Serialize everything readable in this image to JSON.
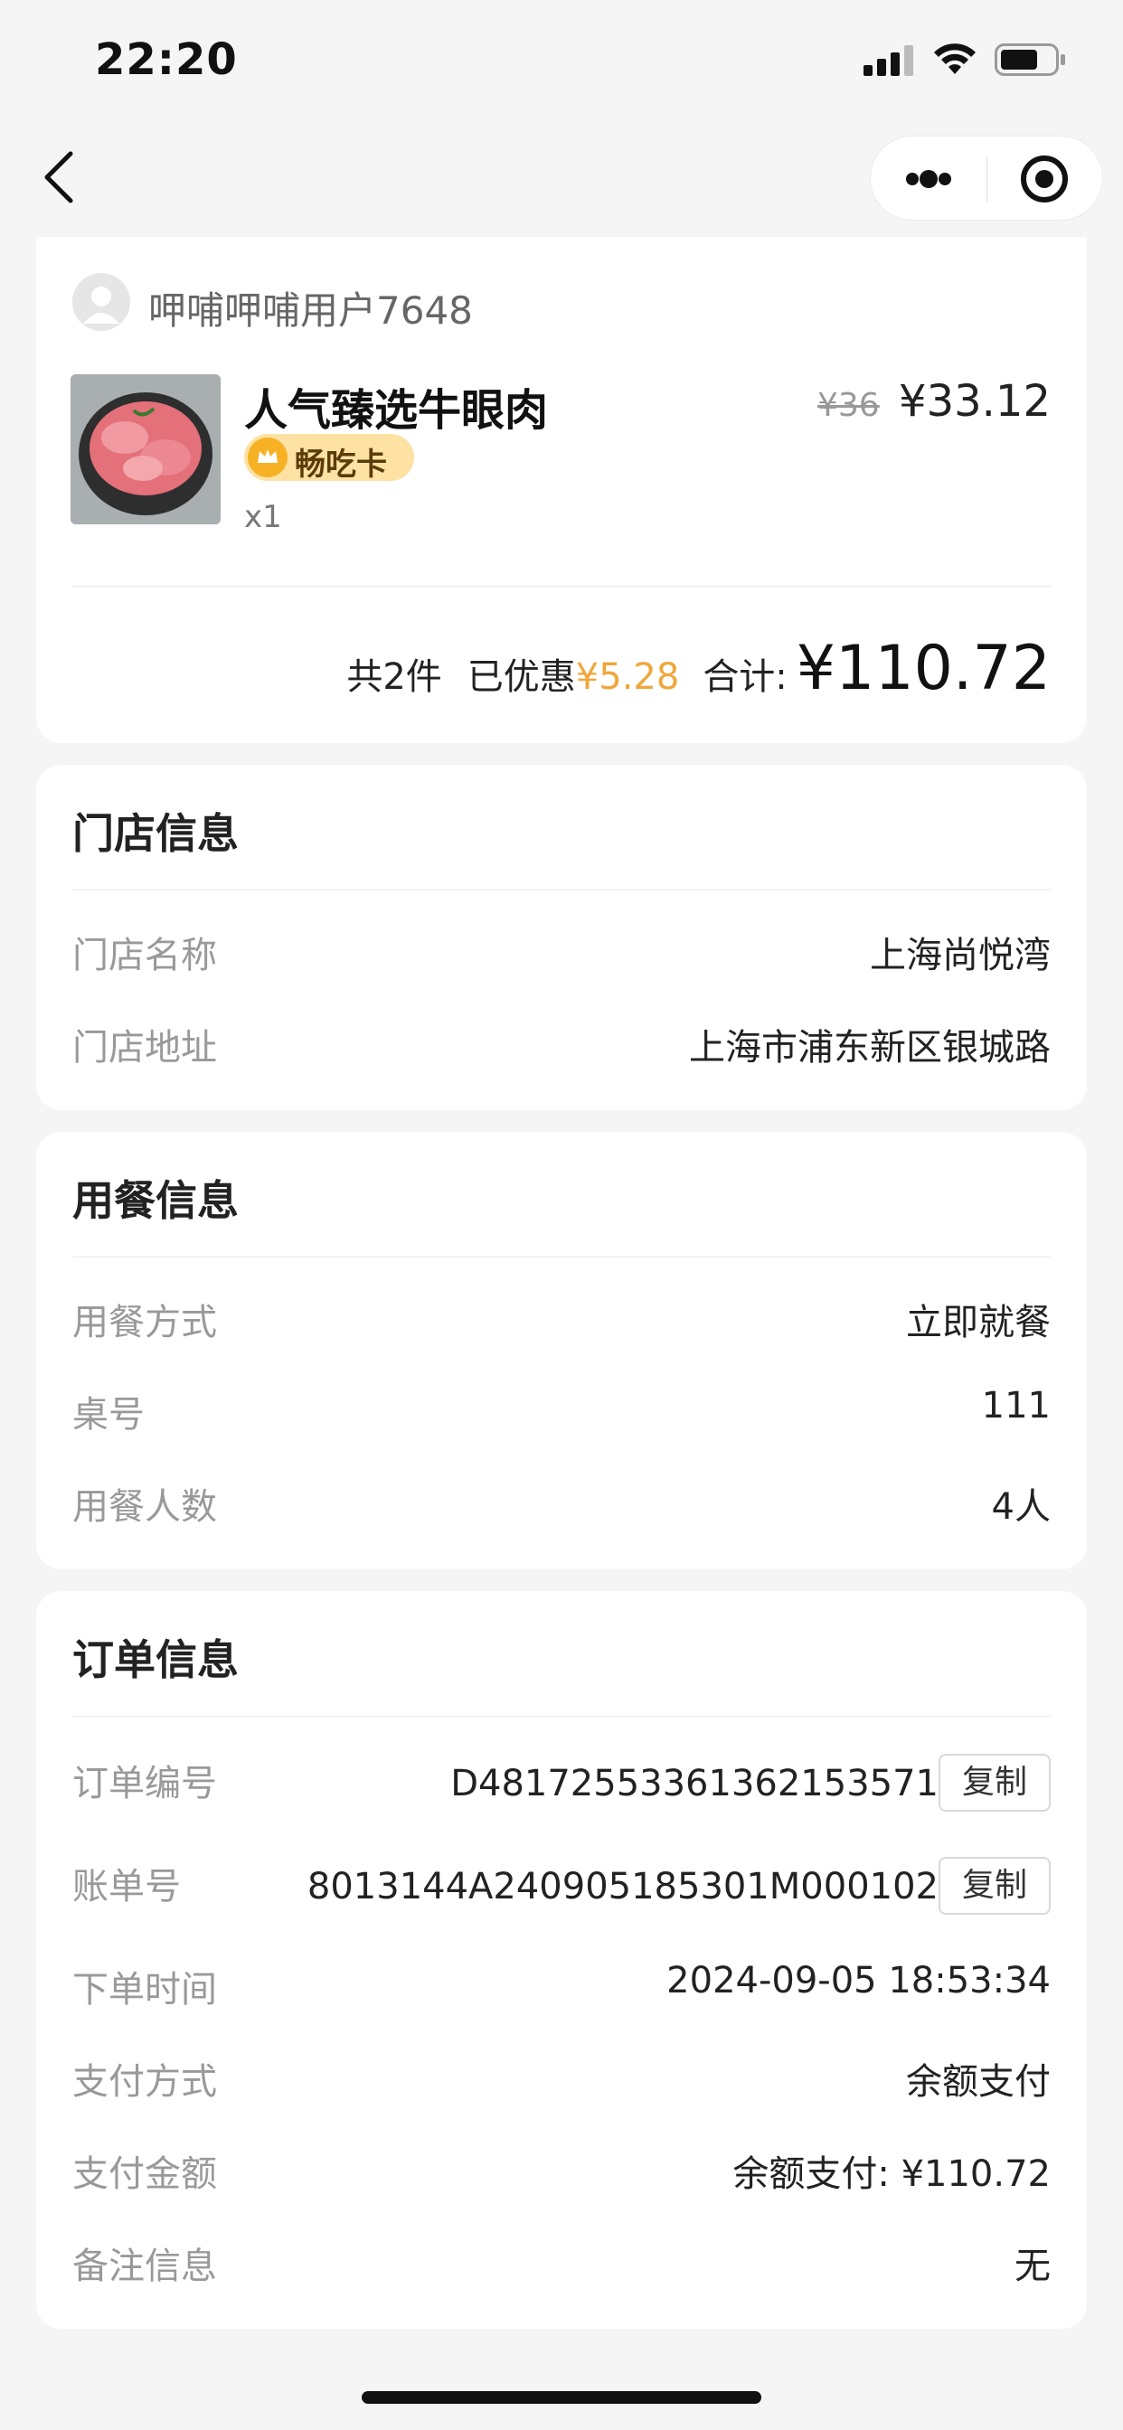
{
  "status_bar": {
    "time": "22:20"
  },
  "nav": {
    "back_icon": "chevron-left-icon",
    "more_icon": "more-dots-icon",
    "close_icon": "target-icon"
  },
  "order": {
    "user_name": "呷哺呷哺用户7648",
    "item": {
      "name": "人气臻选牛眼肉",
      "tag": "畅吃卡",
      "qty": "x1",
      "old_price": "¥36",
      "price": "¥33.12"
    },
    "summary": {
      "count": "共2件",
      "discount_label": "已优惠",
      "discount": "¥5.28",
      "total_label": "合计:",
      "total": "¥110.72"
    }
  },
  "store": {
    "title": "门店信息",
    "rows": [
      {
        "label": "门店名称",
        "value": "上海尚悦湾"
      },
      {
        "label": "门店地址",
        "value": "上海市浦东新区银城路"
      }
    ]
  },
  "dining": {
    "title": "用餐信息",
    "rows": [
      {
        "label": "用餐方式",
        "value": "立即就餐"
      },
      {
        "label": "桌号",
        "value": "111"
      },
      {
        "label": "用餐人数",
        "value": "4人"
      }
    ]
  },
  "order_info": {
    "title": "订单信息",
    "copy_label": "复制",
    "rows": [
      {
        "label": "订单编号",
        "value": "D48172553361362153571"
      },
      {
        "label": "账单号",
        "value": "8013144A240905185301M000102"
      },
      {
        "label": "下单时间",
        "value": "2024-09-05 18:53:34"
      },
      {
        "label": "支付方式",
        "value": "余额支付"
      },
      {
        "label": "支付金额",
        "value": "余额支付: ¥110.72"
      },
      {
        "label": "备注信息",
        "value": "无"
      }
    ]
  },
  "colors": {
    "accent_discount": "#f0a73a",
    "tag_bg": "#fde2a4",
    "page_bg": "#f5f5f5"
  }
}
